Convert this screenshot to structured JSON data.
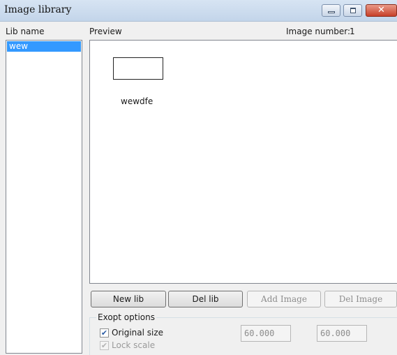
{
  "window": {
    "title": "Image library"
  },
  "controls": {
    "minimize": "minimize",
    "maximize": "maximize",
    "close": "✕"
  },
  "labels": {
    "lib_name": "Lib name",
    "preview": "Preview",
    "image_number": "Image number:",
    "image_number_value": "1"
  },
  "libraries": [
    {
      "name": "wew",
      "selected": true
    }
  ],
  "preview_items": [
    {
      "label": "wewdfe"
    }
  ],
  "buttons": {
    "new_lib": "New lib",
    "del_lib": "Del lib",
    "add_image": "Add Image",
    "del_image": "Del Image"
  },
  "export_options": {
    "title": "Exopt options",
    "original_size": {
      "label": "Original size",
      "checked": true
    },
    "lock_scale": {
      "label": "Lock scale",
      "checked": true,
      "disabled": true
    },
    "width_value": "60.000",
    "height_value": "60.000"
  },
  "colors": {
    "selection": "#3399ff",
    "titlebar": "#c3d5ea",
    "close": "#c7402a"
  }
}
